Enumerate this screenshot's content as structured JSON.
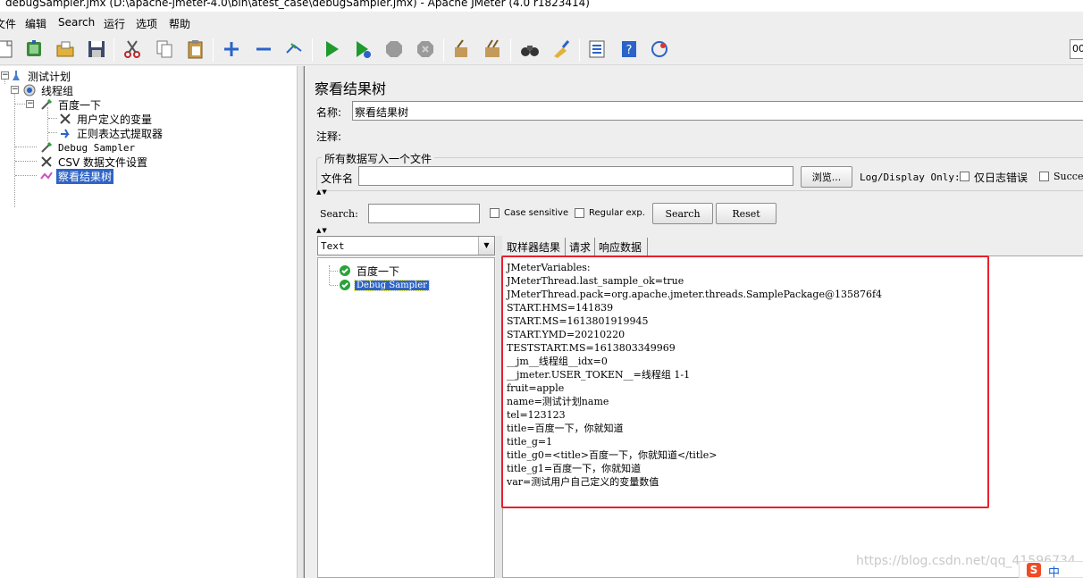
{
  "window": {
    "title": "debugSampler.jmx (D:\\apache-jmeter-4.0\\bin\\atest_case\\debugSampler.jmx) - Apache JMeter (4.0 r1823414)"
  },
  "menu": [
    "文件",
    "编辑",
    "Search",
    "运行",
    "选项",
    "帮助"
  ],
  "toolbar": {
    "icons": [
      "new-icon",
      "templates-icon",
      "open-icon",
      "save-icon",
      "cut-icon",
      "copy-icon",
      "paste-icon",
      "expand-icon",
      "collapse-icon",
      "toggle-icon",
      "start-icon",
      "start-no-pause-icon",
      "stop-icon",
      "shutdown-icon",
      "clear-icon",
      "clear-all-icon",
      "search-icon",
      "reset-search-icon",
      "function-helper-icon",
      "help-icon",
      "remote-icon"
    ],
    "counter": "00"
  },
  "tree": {
    "items": [
      {
        "label": "测试计划",
        "icon": "test-plan-icon"
      },
      {
        "label": "线程组",
        "icon": "thread-group-icon"
      },
      {
        "label": "百度一下",
        "icon": "sampler-icon"
      },
      {
        "label": "用户定义的变量",
        "icon": "config-icon"
      },
      {
        "label": "正则表达式提取器",
        "icon": "extractor-icon"
      },
      {
        "label": "Debug Sampler",
        "icon": "sampler-icon"
      },
      {
        "label": "CSV 数据文件设置",
        "icon": "config-icon"
      },
      {
        "label": "察看结果树",
        "icon": "listener-icon"
      }
    ]
  },
  "panel": {
    "title": "察看结果树",
    "name_label": "名称:",
    "name_value": "察看结果树",
    "comment_label": "注释:",
    "file_group_title": "所有数据写入一个文件",
    "filename_label": "文件名",
    "browse_button": "浏览...",
    "log_display_label": "Log/Display Only:",
    "errors_only_label": "仅日志错误",
    "successes_label": "Successes",
    "search_label": "Search:",
    "case_sensitive_label": "Case sensitive",
    "regex_label": "Regular exp.",
    "search_button": "Search",
    "reset_button": "Reset"
  },
  "results": {
    "renderer": "Text",
    "samples": [
      "百度一下",
      "Debug Sampler"
    ],
    "tabs": [
      "取样器结果",
      "请求",
      "响应数据"
    ],
    "response_lines": [
      "JMeterVariables:",
      "JMeterThread.last_sample_ok=true",
      "JMeterThread.pack=org.apache.jmeter.threads.SamplePackage@135876f4",
      "START.HMS=141839",
      "START.MS=1613801919945",
      "START.YMD=20210220",
      "TESTSTART.MS=1613803349969",
      "__jm__线程组__idx=0",
      "__jmeter.USER_TOKEN__=线程组 1-1",
      "fruit=apple",
      "name=测试计划name",
      "tel=123123",
      "title=百度一下，你就知道",
      "title_g=1",
      "title_g0=<title>百度一下，你就知道</title>",
      "title_g1=百度一下，你就知道",
      "var=测试用户自己定义的变量数值"
    ]
  },
  "watermark": "https://blog.csdn.net/qq_41596734",
  "ime": {
    "label": "中"
  },
  "colors": {
    "selection": "#2f64c5",
    "highlight_border": "#e8202a",
    "success_check": "#2aa23a"
  }
}
